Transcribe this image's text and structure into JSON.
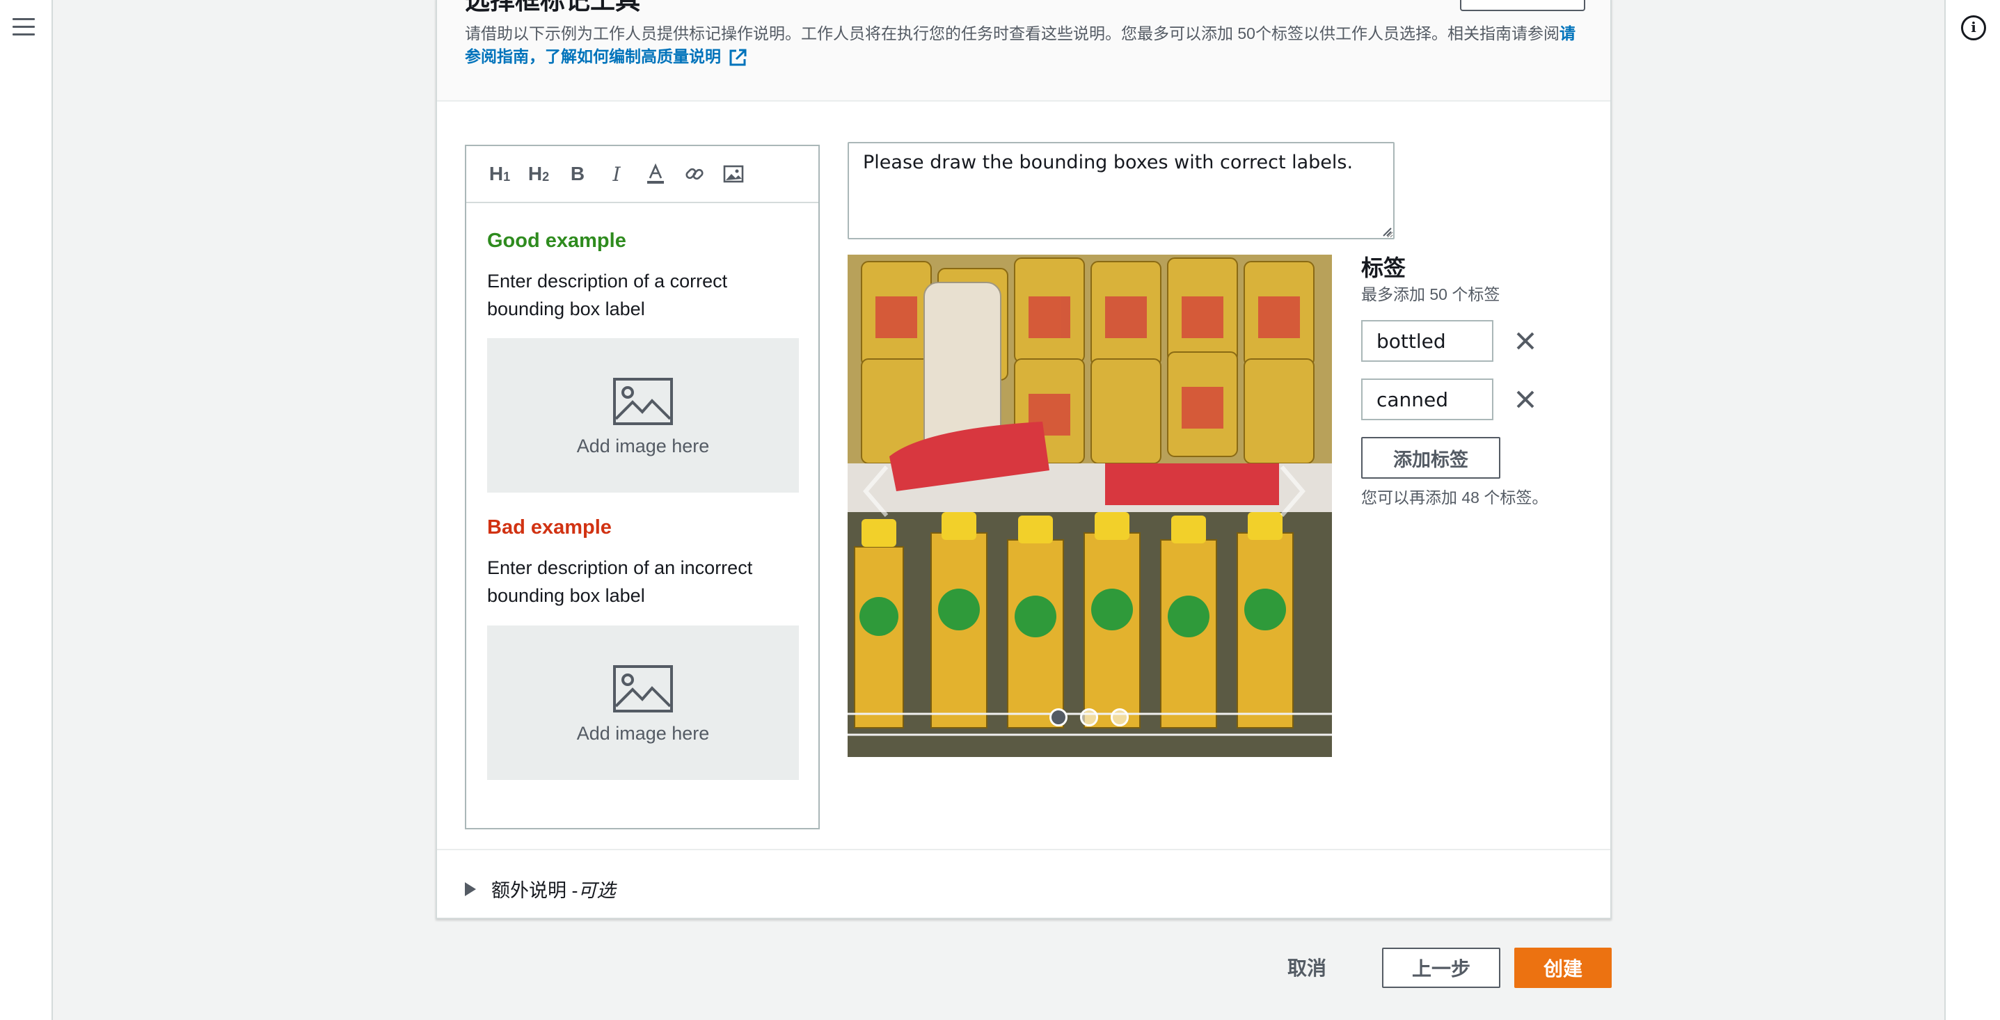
{
  "header": {
    "title": "选择框标记工具",
    "description_prefix": "请借助以下示例为工作人员提供标记操作说明。工作人员将在执行您的任务时查看这些说明。您最多可以添加 50个标签以供工作人员选择。相关指南请参阅",
    "guide_link": "请参阅指南，了解如何编制高质量说明"
  },
  "editor": {
    "toolbar": [
      "H1",
      "H2",
      "B",
      "I",
      "font-color-icon",
      "link-icon",
      "image-icon"
    ],
    "good_heading": "Good example",
    "good_desc": "Enter description of a correct bounding box label",
    "bad_heading": "Bad example",
    "bad_desc": "Enter description of an incorrect bounding box label",
    "add_image": "Add image here"
  },
  "short_instructions": "Please draw the bounding boxes with correct labels.",
  "carousel": {
    "slides": 3,
    "active": 0
  },
  "labels": {
    "title": "标签",
    "subtitle": "最多添加 50 个标签",
    "items": [
      "bottled",
      "canned"
    ],
    "add_button": "添加标签",
    "remaining": "您可以再添加 48 个标签。"
  },
  "extra": {
    "label": "额外说明 - ",
    "optional": "可选"
  },
  "footer": {
    "cancel": "取消",
    "previous": "上一步",
    "create": "创建"
  },
  "colors": {
    "primary": "#ec7211",
    "link": "#0073bb",
    "good": "#2e8b1e",
    "bad": "#d13212"
  }
}
